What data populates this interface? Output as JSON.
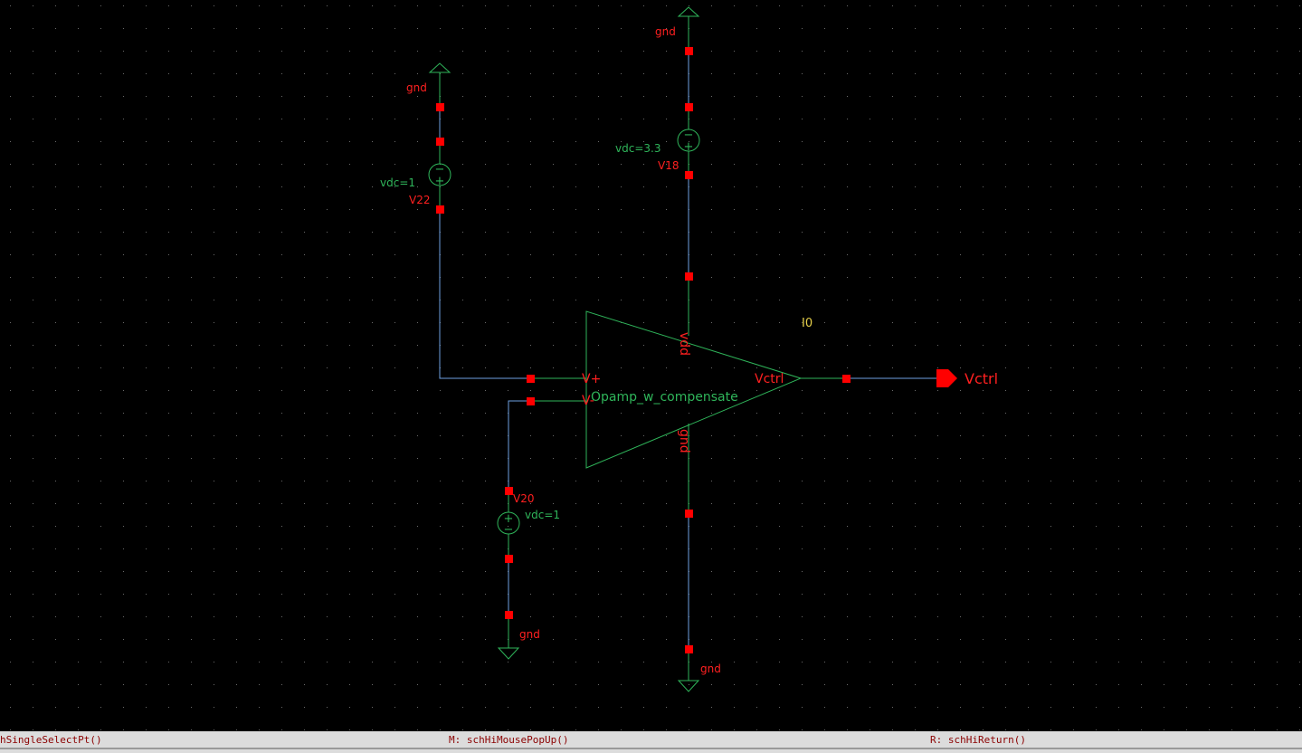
{
  "colors": {
    "background": "#000000",
    "wire": "#6ea0e0",
    "symbol": "#2fb55a",
    "pin_red": "#ff0000",
    "instance_label": "#e6d04a"
  },
  "schematic": {
    "opamp": {
      "cell": "Opamp_w_compensate",
      "instance": "I0",
      "pins": {
        "vplus": "V+",
        "vminus": "V-",
        "vdd": "vdd",
        "gnd": "gnd",
        "out": "Vctrl"
      }
    },
    "sources": [
      {
        "name": "V22",
        "param": "vdc=1",
        "ground": "gnd"
      },
      {
        "name": "V18",
        "param": "vdc=3.3",
        "ground": "gnd"
      },
      {
        "name": "V20",
        "param": "vdc=1",
        "ground": "gnd"
      }
    ],
    "opamp_ground": "gnd",
    "output_pin": "Vctrl",
    "source_symbol_minus": "−",
    "source_symbol_plus": "+"
  },
  "status_bar": {
    "left": "hSingleSelectPt()",
    "middle": "M: schHiMousePopUp()",
    "right": "R: schHiReturn()"
  }
}
